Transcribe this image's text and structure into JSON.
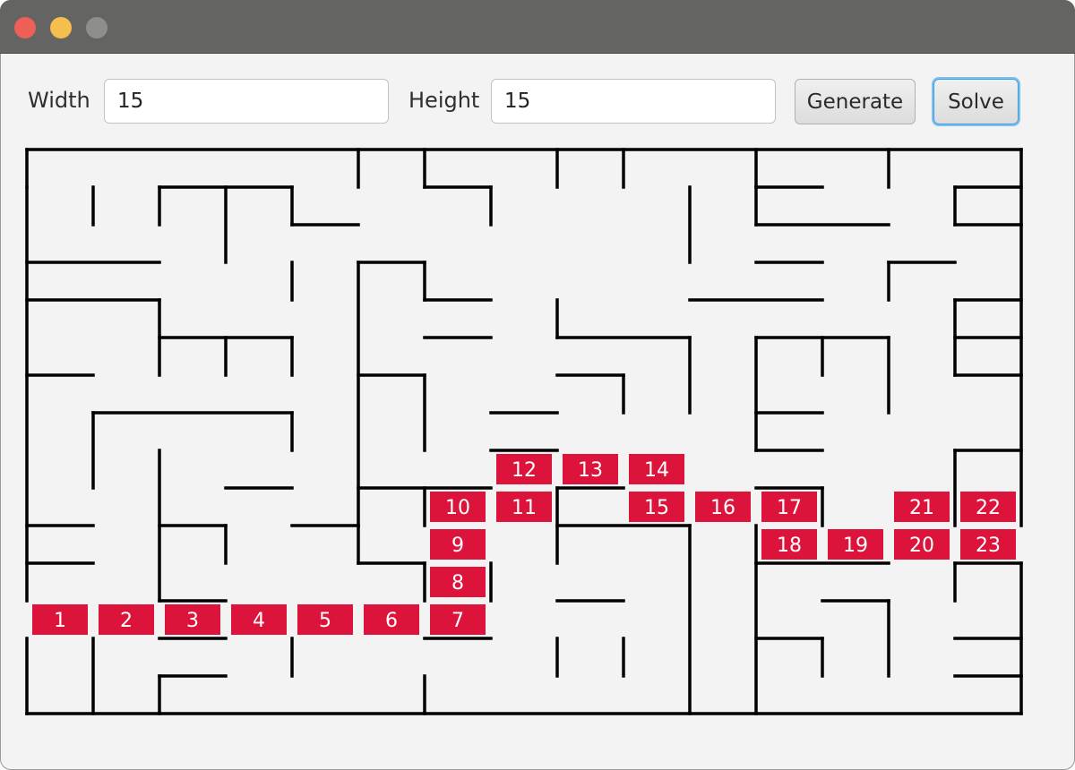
{
  "window": {
    "title": ""
  },
  "controls": {
    "width_label": "Width",
    "width_value": "15",
    "height_label": "Height",
    "height_value": "15",
    "generate_label": "Generate",
    "solve_label": "Solve"
  },
  "maze": {
    "cols": 15,
    "rows": 15,
    "wall_color": "#000000",
    "path_color": "#dc143c",
    "path": [
      {
        "step": "1",
        "col": 0,
        "row": 12
      },
      {
        "step": "2",
        "col": 1,
        "row": 12
      },
      {
        "step": "3",
        "col": 2,
        "row": 12
      },
      {
        "step": "4",
        "col": 3,
        "row": 12
      },
      {
        "step": "5",
        "col": 4,
        "row": 12
      },
      {
        "step": "6",
        "col": 5,
        "row": 12
      },
      {
        "step": "7",
        "col": 6,
        "row": 12
      },
      {
        "step": "8",
        "col": 6,
        "row": 11
      },
      {
        "step": "9",
        "col": 6,
        "row": 10
      },
      {
        "step": "10",
        "col": 6,
        "row": 9
      },
      {
        "step": "11",
        "col": 7,
        "row": 9
      },
      {
        "step": "12",
        "col": 7,
        "row": 8
      },
      {
        "step": "13",
        "col": 8,
        "row": 8
      },
      {
        "step": "14",
        "col": 9,
        "row": 8
      },
      {
        "step": "15",
        "col": 9,
        "row": 9
      },
      {
        "step": "16",
        "col": 10,
        "row": 9
      },
      {
        "step": "17",
        "col": 11,
        "row": 9
      },
      {
        "step": "18",
        "col": 11,
        "row": 10
      },
      {
        "step": "19",
        "col": 12,
        "row": 10
      },
      {
        "step": "20",
        "col": 13,
        "row": 10
      },
      {
        "step": "21",
        "col": 13,
        "row": 9
      },
      {
        "step": "22",
        "col": 14,
        "row": 9
      },
      {
        "step": "23",
        "col": 14,
        "row": 10
      }
    ],
    "walls_h": [
      [
        0,
        1,
        0,
        1
      ],
      [
        2,
        1,
        4,
        1
      ],
      [
        6,
        1,
        7,
        1
      ],
      [
        11,
        1,
        12,
        1
      ],
      [
        14,
        1,
        15,
        1
      ],
      [
        4,
        2,
        5,
        2
      ],
      [
        11,
        2,
        13,
        2
      ],
      [
        14,
        2,
        15,
        2
      ],
      [
        0,
        3,
        2,
        3
      ],
      [
        5,
        3,
        6,
        3
      ],
      [
        11,
        3,
        12,
        3
      ],
      [
        13,
        3,
        14,
        3
      ],
      [
        0,
        4,
        2,
        4
      ],
      [
        6,
        4,
        7,
        4
      ],
      [
        10,
        4,
        12,
        4
      ],
      [
        14,
        4,
        15,
        4
      ],
      [
        2,
        5,
        4,
        5
      ],
      [
        6,
        5,
        7,
        5
      ],
      [
        8,
        5,
        10,
        5
      ],
      [
        11,
        5,
        13,
        5
      ],
      [
        14,
        5,
        15,
        5
      ],
      [
        0,
        6,
        1,
        6
      ],
      [
        5,
        6,
        6,
        6
      ],
      [
        8,
        6,
        9,
        6
      ],
      [
        14,
        6,
        15,
        6
      ],
      [
        1,
        7,
        4,
        7
      ],
      [
        7,
        7,
        8,
        7
      ],
      [
        11,
        7,
        12,
        7
      ],
      [
        7,
        8,
        8,
        8
      ],
      [
        11,
        8,
        12,
        8
      ],
      [
        14,
        8,
        15,
        8
      ],
      [
        3,
        9,
        4,
        9
      ],
      [
        5,
        9,
        7,
        9
      ],
      [
        8,
        9,
        9,
        9
      ],
      [
        11,
        9,
        12,
        9
      ],
      [
        0,
        10,
        1,
        10
      ],
      [
        2,
        10,
        3,
        10
      ],
      [
        4,
        10,
        5,
        10
      ],
      [
        8,
        10,
        10,
        10
      ],
      [
        0,
        11,
        1,
        11
      ],
      [
        5,
        11,
        6,
        11
      ],
      [
        11,
        11,
        13,
        11
      ],
      [
        14,
        11,
        15,
        11
      ],
      [
        2,
        12,
        3,
        12
      ],
      [
        8,
        12,
        9,
        12
      ],
      [
        12,
        12,
        13,
        12
      ],
      [
        2,
        13,
        3,
        13
      ],
      [
        6,
        13,
        7,
        13
      ],
      [
        11,
        13,
        12,
        13
      ],
      [
        14,
        13,
        15,
        13
      ],
      [
        2,
        14,
        3,
        14
      ],
      [
        14,
        14,
        15,
        14
      ]
    ],
    "walls_v": [
      [
        5,
        0,
        5,
        1
      ],
      [
        6,
        0,
        6,
        1
      ],
      [
        8,
        0,
        8,
        1
      ],
      [
        9,
        0,
        9,
        1
      ],
      [
        11,
        0,
        11,
        1
      ],
      [
        13,
        0,
        13,
        1
      ],
      [
        1,
        1,
        1,
        2
      ],
      [
        2,
        1,
        2,
        2
      ],
      [
        3,
        1,
        3,
        3
      ],
      [
        4,
        1,
        4,
        2
      ],
      [
        7,
        1,
        7,
        2
      ],
      [
        10,
        1,
        10,
        3
      ],
      [
        11,
        1,
        11,
        2
      ],
      [
        14,
        1,
        14,
        2
      ],
      [
        4,
        3,
        4,
        4
      ],
      [
        5,
        3,
        5,
        10
      ],
      [
        6,
        3,
        6,
        4
      ],
      [
        13,
        3,
        13,
        4
      ],
      [
        2,
        4,
        2,
        6
      ],
      [
        8,
        4,
        8,
        5
      ],
      [
        14,
        4,
        14,
        6
      ],
      [
        3,
        5,
        3,
        6
      ],
      [
        4,
        5,
        4,
        6
      ],
      [
        10,
        5,
        10,
        7
      ],
      [
        11,
        5,
        11,
        8
      ],
      [
        12,
        5,
        12,
        6
      ],
      [
        13,
        5,
        13,
        7
      ],
      [
        6,
        6,
        6,
        8
      ],
      [
        9,
        6,
        9,
        7
      ],
      [
        1,
        7,
        1,
        9
      ],
      [
        4,
        7,
        4,
        8
      ],
      [
        2,
        8,
        2,
        12
      ],
      [
        14,
        8,
        14,
        10
      ],
      [
        6,
        9,
        6,
        10
      ],
      [
        8,
        9,
        8,
        11
      ],
      [
        12,
        9,
        12,
        10
      ],
      [
        3,
        10,
        3,
        11
      ],
      [
        5,
        10,
        5,
        11
      ],
      [
        10,
        10,
        10,
        15
      ],
      [
        11,
        10,
        11,
        15
      ],
      [
        6,
        11,
        6,
        12
      ],
      [
        7,
        11,
        7,
        12
      ],
      [
        14,
        11,
        14,
        12
      ],
      [
        13,
        12,
        13,
        14
      ],
      [
        1,
        13,
        1,
        15
      ],
      [
        4,
        13,
        4,
        14
      ],
      [
        8,
        13,
        8,
        14
      ],
      [
        9,
        13,
        9,
        14
      ],
      [
        12,
        13,
        12,
        14
      ],
      [
        2,
        14,
        2,
        15
      ],
      [
        6,
        14,
        6,
        15
      ]
    ]
  }
}
